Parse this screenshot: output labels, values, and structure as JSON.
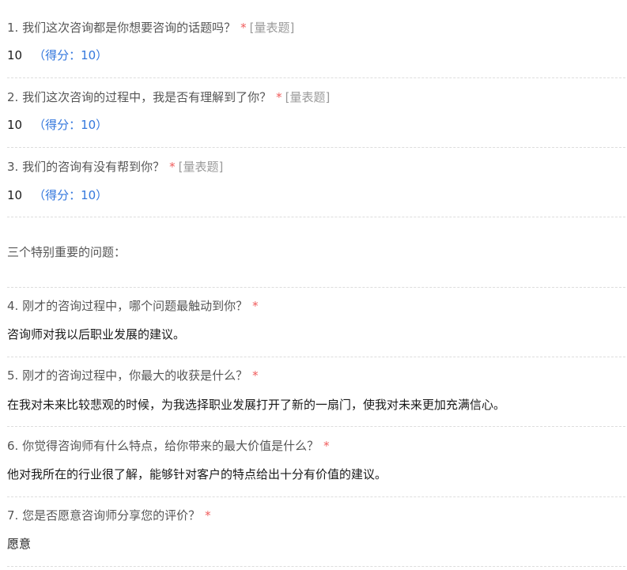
{
  "questions": [
    {
      "number": "1.",
      "title": "我们这次咨询都是你想要咨询的话题吗？",
      "required": "*",
      "tag": "[量表题]",
      "answer": "10",
      "score": "（得分：10）"
    },
    {
      "number": "2.",
      "title": "我们这次咨询的过程中，我是否有理解到了你？",
      "required": "*",
      "tag": "[量表题]",
      "answer": "10",
      "score": "（得分：10）"
    },
    {
      "number": "3.",
      "title": "我们的咨询有没有帮到你？",
      "required": "*",
      "tag": "[量表题]",
      "answer": "10",
      "score": "（得分：10）"
    },
    {
      "number": "4.",
      "title": "刚才的咨询过程中，哪个问题最触动到你？",
      "required": "*",
      "answer": "咨询师对我以后职业发展的建议。"
    },
    {
      "number": "5.",
      "title": "刚才的咨询过程中，你最大的收获是什么？",
      "required": "*",
      "answer": "在我对未来比较悲观的时候，为我选择职业发展打开了新的一扇门，使我对未来更加充满信心。"
    },
    {
      "number": "6.",
      "title": "你觉得咨询师有什么特点，给你带来的最大价值是什么？",
      "required": "*",
      "answer": "他对我所在的行业很了解，能够针对客户的特点给出十分有价值的建议。"
    },
    {
      "number": "7.",
      "title": "您是否愿意咨询师分享您的评价？",
      "required": "*",
      "answer": "愿意"
    }
  ],
  "section_title": "三个特别重要的问题："
}
